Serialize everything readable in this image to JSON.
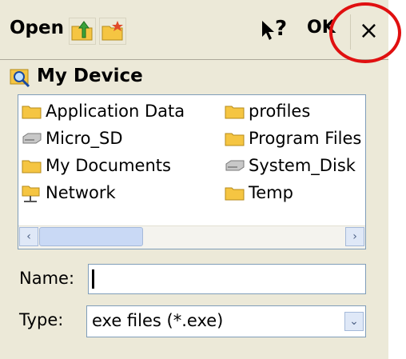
{
  "dialog": {
    "title": "Open",
    "help_label": "?",
    "ok_label": "OK",
    "close_label": "×"
  },
  "location": {
    "label": "My Device"
  },
  "files": {
    "col1": [
      {
        "label": "Application Data",
        "icon": "folder-icon"
      },
      {
        "label": "Micro_SD",
        "icon": "drive-icon"
      },
      {
        "label": "My Documents",
        "icon": "folder-icon"
      },
      {
        "label": "Network",
        "icon": "network-icon"
      }
    ],
    "col2": [
      {
        "label": "profiles",
        "icon": "folder-icon"
      },
      {
        "label": "Program Files",
        "icon": "folder-icon"
      },
      {
        "label": "System_Disk",
        "icon": "drive-icon"
      },
      {
        "label": "Temp",
        "icon": "folder-icon"
      }
    ]
  },
  "scrollbar": {
    "left_arrow": "‹",
    "right_arrow": "›"
  },
  "name_field": {
    "label": "Name:",
    "value": ""
  },
  "type_field": {
    "label": "Type:",
    "value": "exe files (*.exe)",
    "dropdown_arrow": "⌄"
  },
  "colors": {
    "dialog_bg": "#ece9d8",
    "highlight_circle": "#e01010",
    "folder": "#f5c542"
  }
}
